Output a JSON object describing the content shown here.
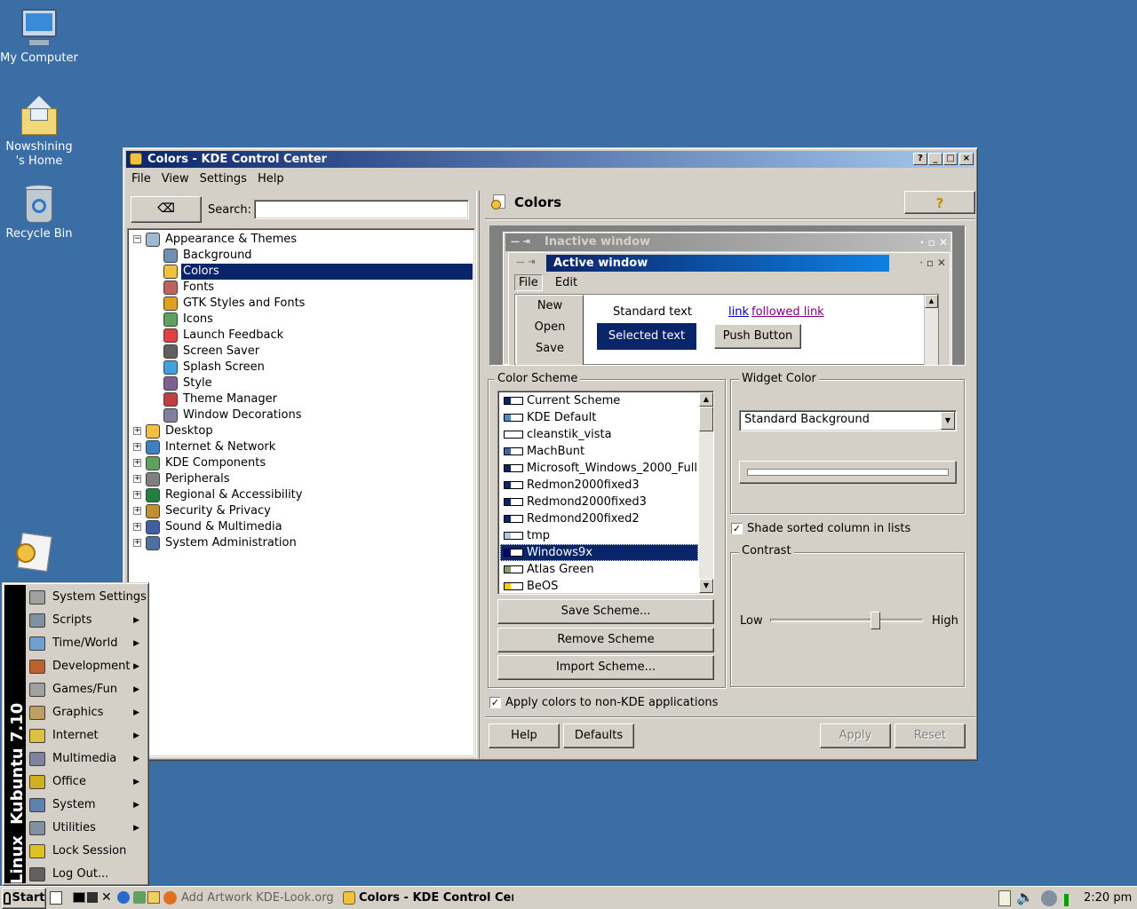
{
  "desktop": {
    "icons": [
      {
        "label": "My Computer",
        "icon": "computer-icon"
      },
      {
        "label": "Nowshining 's Home",
        "icon": "home-folder-icon"
      },
      {
        "label": "Recycle Bin",
        "icon": "recycle-bin-icon"
      }
    ],
    "background_color": "#3a6ea5"
  },
  "window": {
    "title": "Colors - KDE Control Center",
    "menu": [
      "File",
      "View",
      "Settings",
      "Help"
    ],
    "title_buttons": [
      "?",
      "_",
      "□",
      "×"
    ]
  },
  "left_pane": {
    "search_label": "Search:",
    "search_value": "",
    "tree": [
      {
        "label": "Appearance & Themes",
        "expanded": true,
        "icon": "appearance-icon"
      },
      {
        "label": "Background",
        "child": true,
        "icon": "background-icon"
      },
      {
        "label": "Colors",
        "child": true,
        "selected": true,
        "icon": "colors-icon"
      },
      {
        "label": "Fonts",
        "child": true,
        "icon": "fonts-icon"
      },
      {
        "label": "GTK Styles and Fonts",
        "child": true,
        "icon": "gtk-icon"
      },
      {
        "label": "Icons",
        "child": true,
        "icon": "icons-icon"
      },
      {
        "label": "Launch Feedback",
        "child": true,
        "icon": "launch-feedback-icon"
      },
      {
        "label": "Screen Saver",
        "child": true,
        "icon": "screensaver-icon"
      },
      {
        "label": "Splash Screen",
        "child": true,
        "icon": "splash-icon"
      },
      {
        "label": "Style",
        "child": true,
        "icon": "style-icon"
      },
      {
        "label": "Theme Manager",
        "child": true,
        "icon": "theme-manager-icon"
      },
      {
        "label": "Window Decorations",
        "child": true,
        "icon": "window-decorations-icon"
      },
      {
        "label": "Desktop",
        "icon": "desktop-icon"
      },
      {
        "label": "Internet & Network",
        "icon": "network-icon"
      },
      {
        "label": "KDE Components",
        "icon": "kde-components-icon"
      },
      {
        "label": "Peripherals",
        "icon": "peripherals-icon"
      },
      {
        "label": "Regional & Accessibility",
        "icon": "regional-icon"
      },
      {
        "label": "Security & Privacy",
        "icon": "security-icon"
      },
      {
        "label": "Sound & Multimedia",
        "icon": "sound-icon"
      },
      {
        "label": "System Administration",
        "icon": "sysadmin-icon"
      }
    ]
  },
  "right_pane": {
    "header": "Colors",
    "help_icon": "?",
    "preview": {
      "inactive_title": "Inactive window",
      "active_title": "Active window",
      "menu": [
        "File",
        "Edit"
      ],
      "popup_items": [
        "New",
        "Open",
        "Save"
      ],
      "standard_text": "Standard text",
      "selected_text": "Selected text",
      "link": "link",
      "followed_link": "followed link",
      "push_button": "Push Button"
    },
    "color_scheme": {
      "label": "Color Scheme",
      "items": [
        {
          "name": "Current Scheme",
          "swatch": "#0a246a"
        },
        {
          "name": "KDE Default",
          "swatch": "#4a8ccc"
        },
        {
          "name": "cleanstik_vista",
          "swatch": "#ffffff"
        },
        {
          "name": "MachBunt",
          "swatch": "#4466aa"
        },
        {
          "name": "Microsoft_Windows_2000_Full",
          "swatch": "#0a246a"
        },
        {
          "name": "Redmon2000fixed3",
          "swatch": "#0a246a"
        },
        {
          "name": "Redmond2000fixed3",
          "swatch": "#0a246a"
        },
        {
          "name": "Redmond200fixed2",
          "swatch": "#0a246a"
        },
        {
          "name": "tmp",
          "swatch": "#b0c8e0"
        },
        {
          "name": "Windows9x",
          "swatch": "#000080",
          "selected": true
        },
        {
          "name": "Atlas Green",
          "swatch": "#8a9a70"
        },
        {
          "name": "BeOS",
          "swatch": "#ffcc00"
        }
      ],
      "buttons": [
        "Save Scheme...",
        "Remove Scheme",
        "Import Scheme..."
      ]
    },
    "widget_color": {
      "label": "Widget Color",
      "selected": "Standard Background"
    },
    "shade_sorted_label": "Shade sorted column in lists",
    "shade_sorted_checked": true,
    "contrast": {
      "label": "Contrast",
      "low": "Low",
      "high": "High",
      "value_fraction": 0.7
    },
    "apply_non_kde_label": "Apply colors to non-KDE applications",
    "apply_non_kde_checked": true,
    "buttons": {
      "help": "Help",
      "defaults": "Defaults",
      "apply": "Apply",
      "reset": "Reset"
    }
  },
  "start_menu": {
    "side_text": "Kubuntu 7.10",
    "side_text_prefix": "Linux",
    "items": [
      {
        "label": "System Settings",
        "submenu": false,
        "icon": "system-settings-icon"
      },
      {
        "label": "Scripts",
        "submenu": true,
        "icon": "scripts-icon"
      },
      {
        "label": "Time/World",
        "submenu": true,
        "icon": "clock-icon"
      },
      {
        "label": "Development",
        "submenu": true,
        "icon": "development-icon"
      },
      {
        "label": "Games/Fun",
        "submenu": true,
        "icon": "games-icon"
      },
      {
        "label": "Graphics",
        "submenu": true,
        "icon": "graphics-icon"
      },
      {
        "label": "Internet",
        "submenu": true,
        "icon": "internet-icon"
      },
      {
        "label": "Multimedia",
        "submenu": true,
        "icon": "multimedia-icon"
      },
      {
        "label": "Office",
        "submenu": true,
        "icon": "office-icon"
      },
      {
        "label": "System",
        "submenu": true,
        "icon": "system-icon"
      },
      {
        "label": "Utilities",
        "submenu": true,
        "icon": "utilities-icon"
      },
      {
        "label": "Lock Session",
        "submenu": false,
        "icon": "lock-icon"
      },
      {
        "label": "Log Out...",
        "submenu": false,
        "icon": "logout-icon"
      }
    ]
  },
  "taskbar": {
    "start_label": "Start",
    "tasks": [
      {
        "label": "Add Artwork KDE-Look.org - F",
        "active": false
      },
      {
        "label": "Colors - KDE Control Cent",
        "active": true
      }
    ],
    "clock": "2:20 pm"
  }
}
